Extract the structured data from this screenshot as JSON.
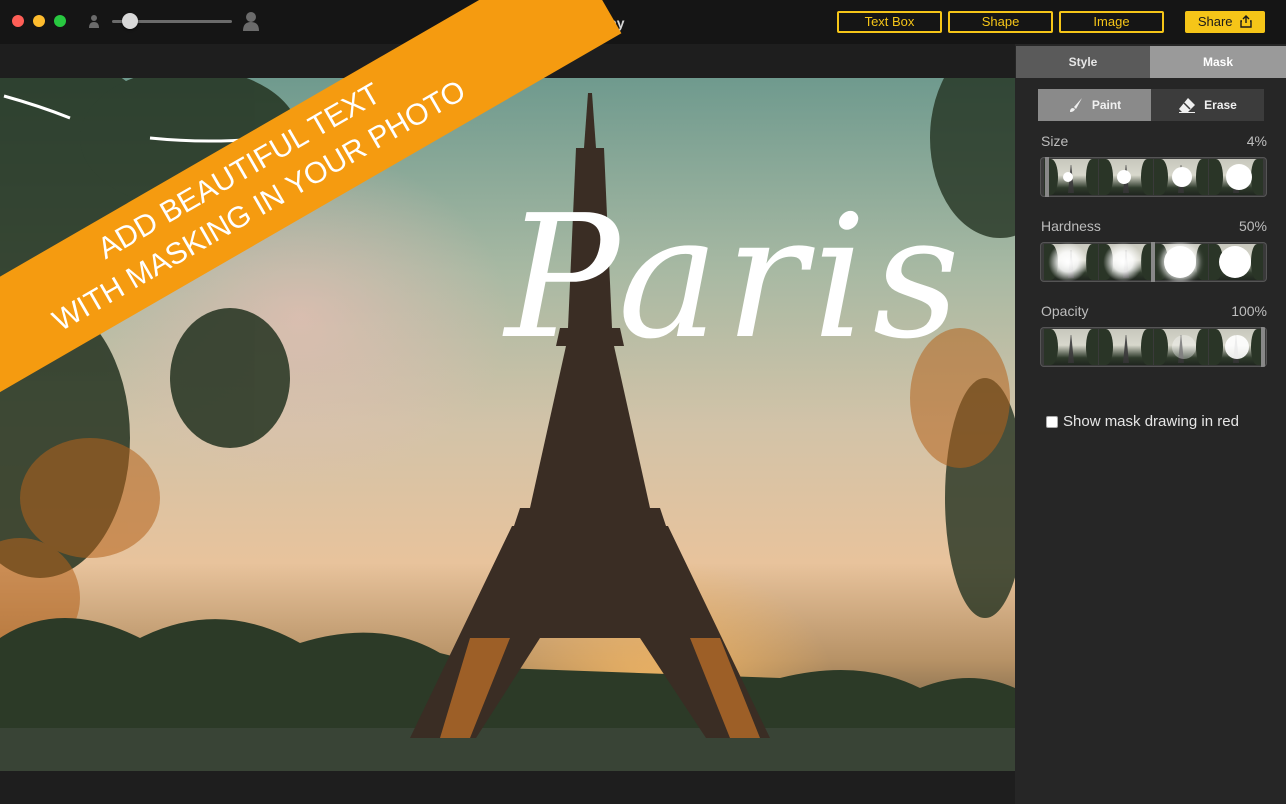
{
  "app": {
    "title": "Typography"
  },
  "toolbar": {
    "text_box_label": "Text Box",
    "shape_label": "Shape",
    "image_label": "Image",
    "share_label": "Share",
    "accent_color": "#f5c518"
  },
  "zoom": {
    "level_fraction": 0.15
  },
  "banner": {
    "line1": "ADD BEAUTIFUL TEXT",
    "line2": "WITH MASKING IN YOUR PHOTO",
    "color": "#f59b10"
  },
  "canvas": {
    "overlay_text": "Paris"
  },
  "panel": {
    "tabs": [
      {
        "label": "Style"
      },
      {
        "label": "Mask"
      }
    ],
    "active_tab": "Mask",
    "modes": [
      {
        "label": "Paint"
      },
      {
        "label": "Erase"
      }
    ],
    "active_mode": "Paint",
    "size": {
      "label": "Size",
      "value": "4%"
    },
    "hardness": {
      "label": "Hardness",
      "value": "50%"
    },
    "opacity": {
      "label": "Opacity",
      "value": "100%"
    },
    "show_mask_label": "Show mask drawing in red",
    "show_mask_checked": false
  }
}
